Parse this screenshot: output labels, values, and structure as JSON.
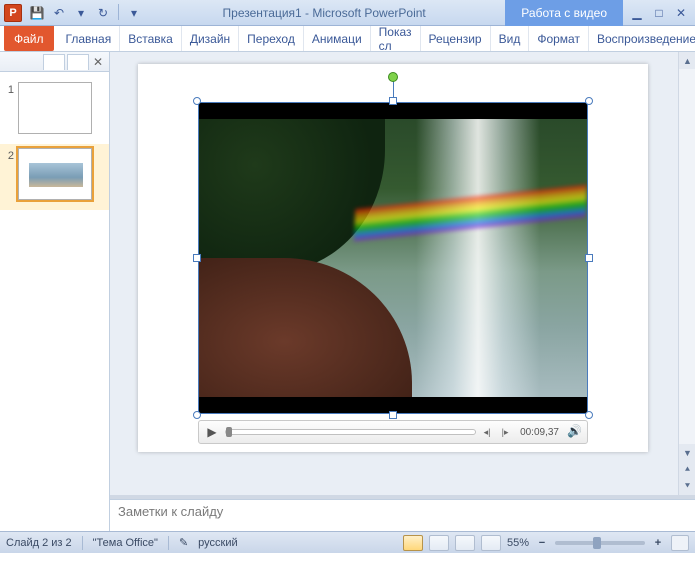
{
  "title_bar": {
    "document_name": "Презентация1",
    "app_name": "Microsoft PowerPoint",
    "separator": "  -  ",
    "context_tab": "Работа с видео"
  },
  "qat": {
    "save_icon": "💾",
    "undo_icon": "↶",
    "redo_icon": "↻"
  },
  "ribbon": {
    "file": "Файл",
    "tabs": [
      "Главная",
      "Вставка",
      "Дизайн",
      "Переход",
      "Анимаци",
      "Показ сл",
      "Рецензир",
      "Вид",
      "Формат",
      "Воспроизведение"
    ]
  },
  "thumbnails": {
    "slides": [
      {
        "num": "1"
      },
      {
        "num": "2"
      }
    ],
    "selected_index": 1
  },
  "player": {
    "time": "00:09,37"
  },
  "notes": {
    "placeholder": "Заметки к слайду"
  },
  "status": {
    "slide_info": "Слайд 2 из 2",
    "theme": "\"Тема Office\"",
    "language": "русский",
    "zoom": "55%"
  },
  "icons": {
    "play": "▶",
    "step_back": "◂|",
    "step_fwd": "|▸",
    "volume": "🔊",
    "minimize": "▁",
    "maximize": "□",
    "close": "✕",
    "collapse": "▴",
    "help": "?",
    "dropdown": "▾",
    "lang": "✎"
  }
}
